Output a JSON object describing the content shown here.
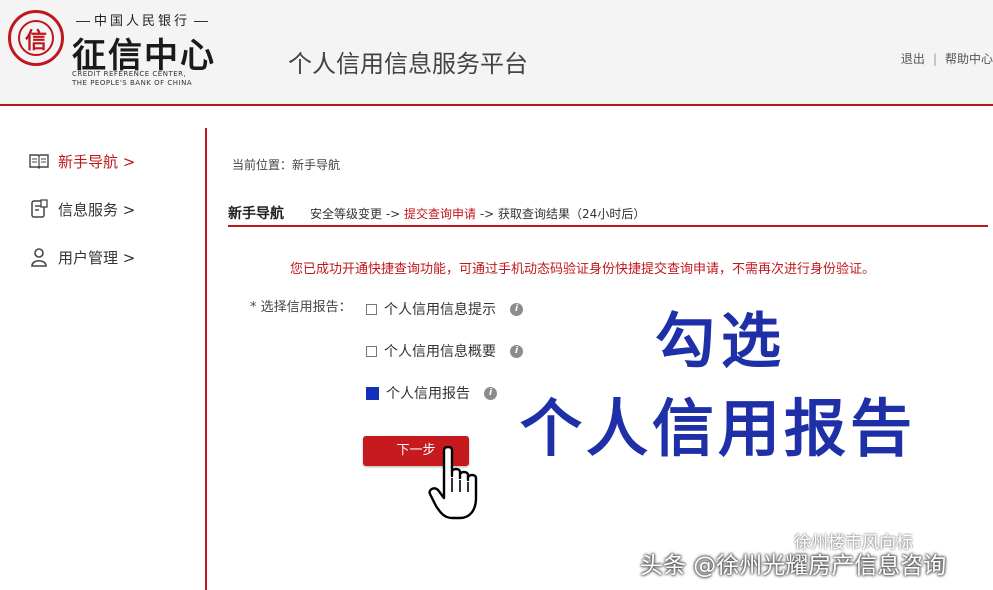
{
  "header": {
    "logo_org": "中国人民银行",
    "logo_title": "征信中心",
    "logo_en_line1": "CREDIT REFERENCE CENTER,",
    "logo_en_line2": "THE PEOPLE'S BANK OF CHINA",
    "platform_title": "个人信用信息服务平台",
    "logout_label": "退出",
    "separator": "|",
    "help_label": "帮助中心"
  },
  "sidebar": {
    "items": [
      {
        "label": "新手导航 >",
        "icon": "book-icon",
        "active": true
      },
      {
        "label": "信息服务 >",
        "icon": "document-icon",
        "active": false
      },
      {
        "label": "用户管理 >",
        "icon": "user-icon",
        "active": false
      }
    ]
  },
  "main": {
    "breadcrumb": "当前位置：新手导航",
    "tab_title": "新手导航",
    "steps": {
      "step1": "安全等级变更 -> ",
      "step2": "提交查询申请",
      "step3": " -> 获取查询结果（24小时后）"
    },
    "notice": "您已成功开通快捷查询功能，可通过手机动态码验证身份快捷提交查询申请，不需再次进行身份验证。",
    "report_label": "* 选择信用报告：",
    "options": [
      {
        "label": "个人信用信息提示",
        "checked": false
      },
      {
        "label": "个人信用信息概要",
        "checked": false
      },
      {
        "label": "个人信用报告",
        "checked": true
      }
    ],
    "info_icon_text": "i",
    "next_button": "下一步"
  },
  "annotation": {
    "line1": "勾选",
    "line2": "个人信用报告"
  },
  "watermarks": {
    "account": "徐州楼市风向标",
    "source": "头条 @徐州光耀房产信息咨询"
  },
  "colors": {
    "brand_red": "#c0171d",
    "annotation_blue": "#1e2fa8",
    "checked_blue": "#1030b8"
  }
}
